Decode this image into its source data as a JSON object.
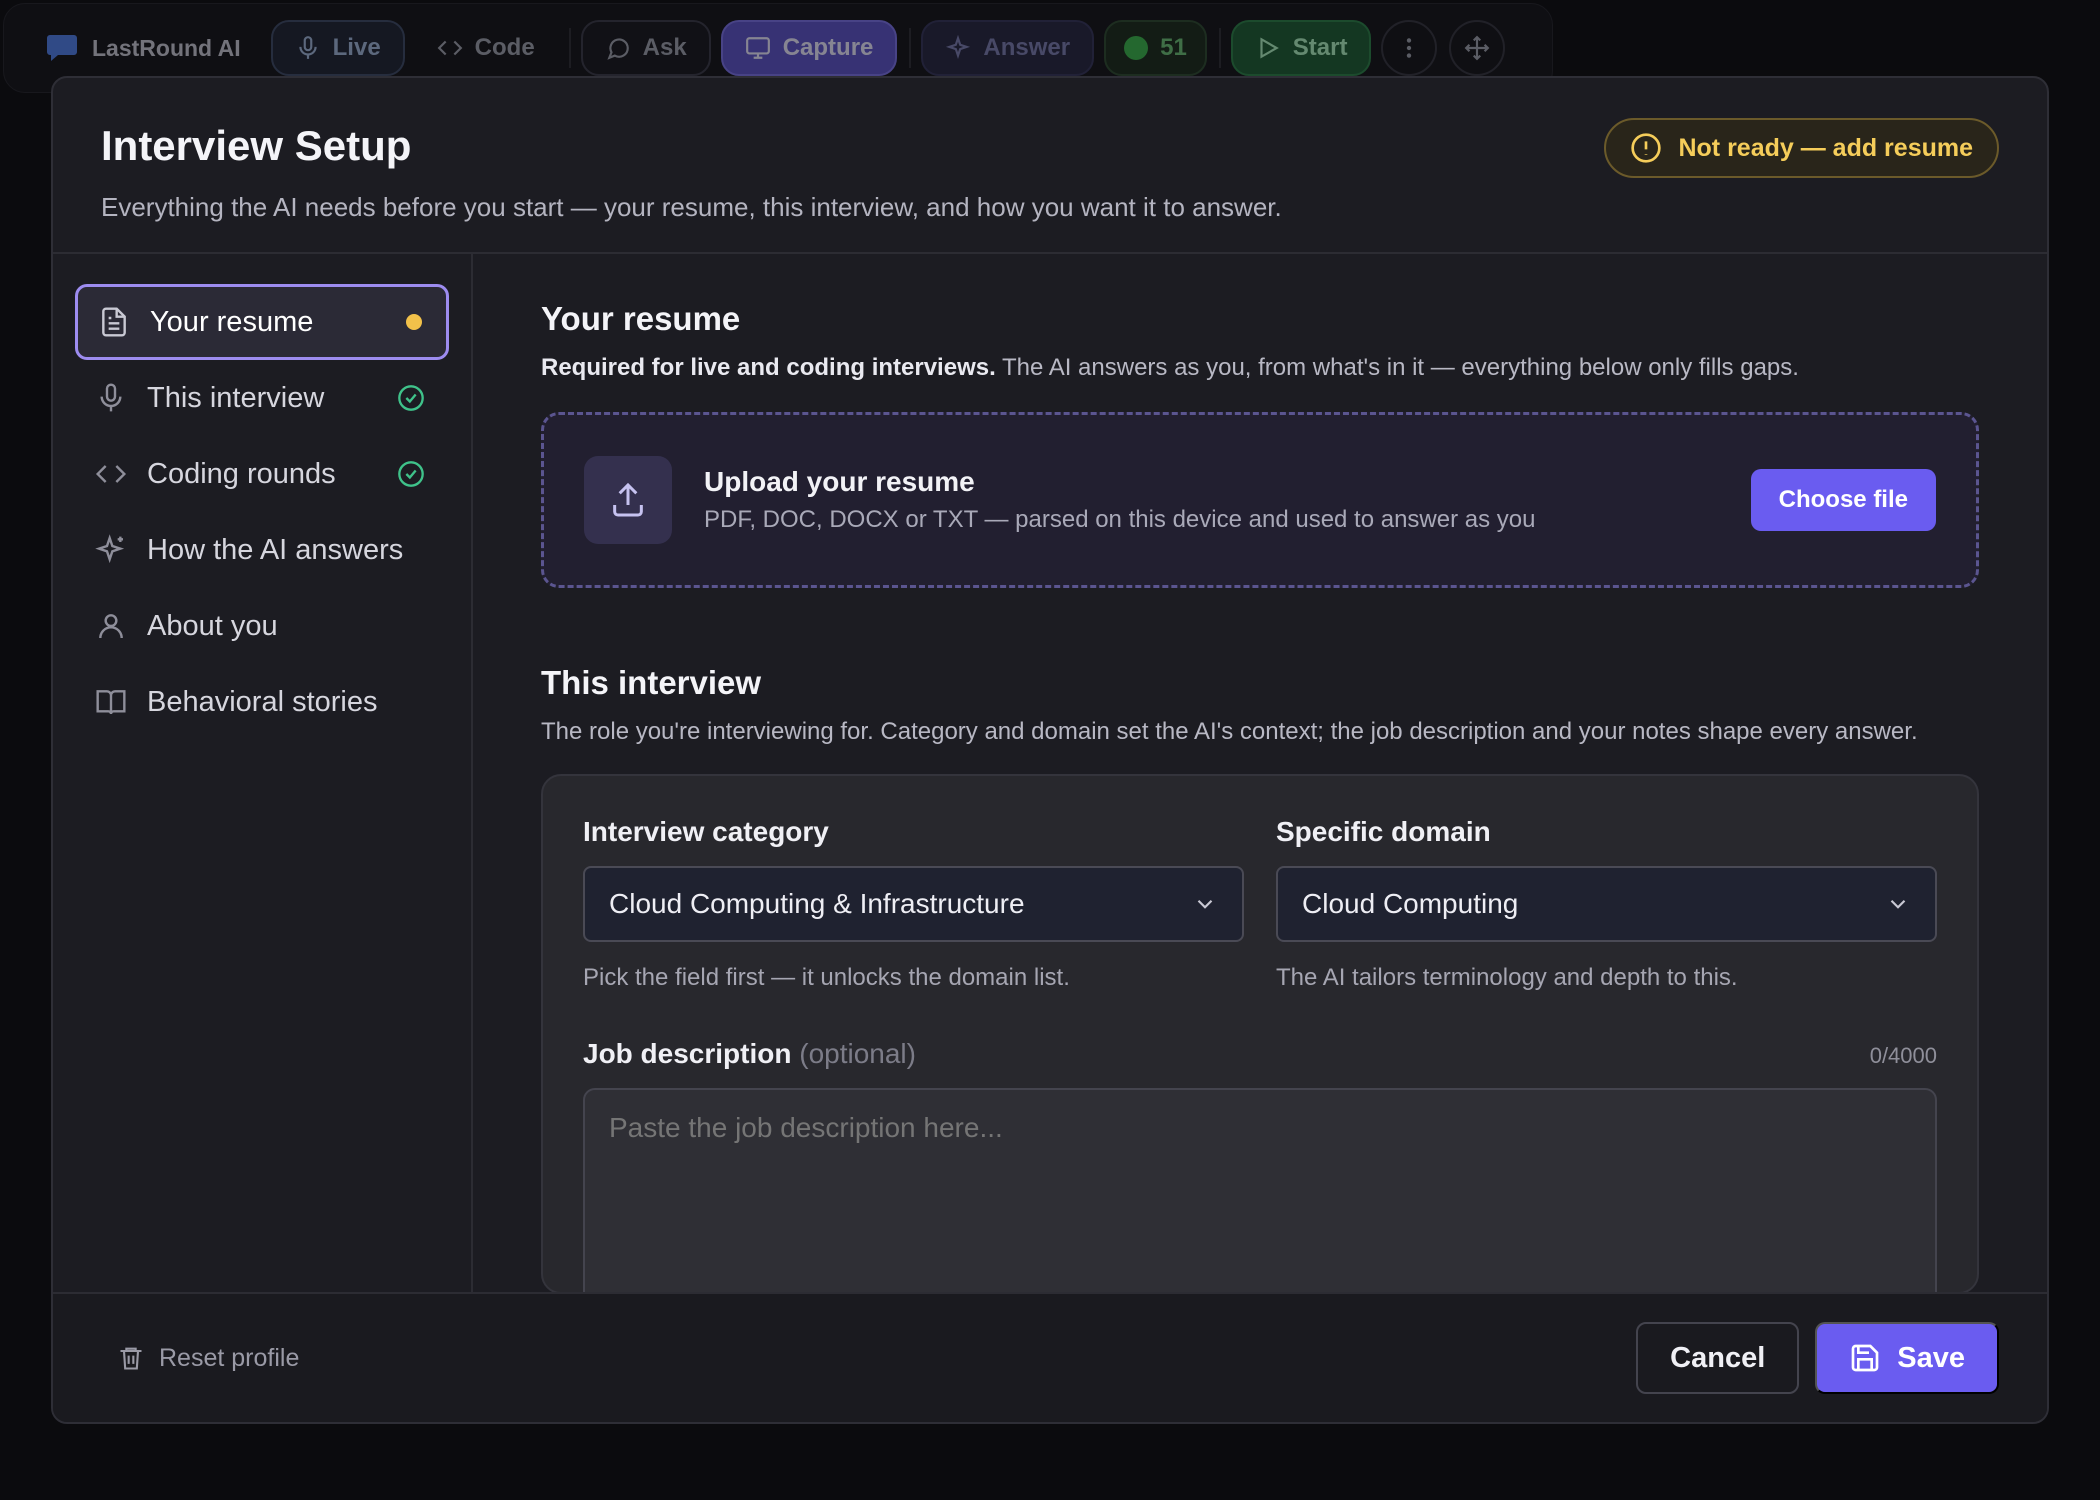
{
  "toolbar": {
    "brand": "LastRound AI",
    "live": "Live",
    "code": "Code",
    "ask": "Ask",
    "capture": "Capture",
    "answer": "Answer",
    "count": "51",
    "start": "Start"
  },
  "modal": {
    "title": "Interview Setup",
    "subtitle": "Everything the AI needs before you start — your resume, this interview, and how you want it to answer.",
    "status": "Not ready — add resume"
  },
  "sidebar": {
    "items": [
      {
        "label": "Your resume",
        "icon": "file-icon",
        "state": "pending"
      },
      {
        "label": "This interview",
        "icon": "microphone-icon",
        "state": "done"
      },
      {
        "label": "Coding rounds",
        "icon": "code-icon",
        "state": "done"
      },
      {
        "label": "How the AI answers",
        "icon": "sparkles-icon",
        "state": "none"
      },
      {
        "label": "About you",
        "icon": "user-icon",
        "state": "none"
      },
      {
        "label": "Behavioral stories",
        "icon": "book-icon",
        "state": "none"
      }
    ]
  },
  "resume": {
    "title": "Your resume",
    "desc_bold": "Required for live and coding interviews.",
    "desc_rest": " The AI answers as you, from what's in it — everything below only fills gaps.",
    "upload_title": "Upload your resume",
    "upload_sub": "PDF, DOC, DOCX or TXT — parsed on this device and used to answer as you",
    "choose_label": "Choose file"
  },
  "interview": {
    "title": "This interview",
    "desc": "The role you're interviewing for. Category and domain set the AI's context; the job description and your notes shape every answer.",
    "category_label": "Interview category",
    "category_value": "Cloud Computing & Infrastructure",
    "category_help": "Pick the field first — it unlocks the domain list.",
    "domain_label": "Specific domain",
    "domain_value": "Cloud Computing",
    "domain_help": "The AI tailors terminology and depth to this.",
    "jd_label": "Job description",
    "jd_optional": "(optional)",
    "jd_count": "0/4000",
    "jd_placeholder": "Paste the job description here..."
  },
  "footer": {
    "reset": "Reset profile",
    "cancel": "Cancel",
    "save": "Save"
  },
  "colors": {
    "accent": "#6a5cf0",
    "warning": "#f5cd5a",
    "success": "#3fc28a"
  }
}
